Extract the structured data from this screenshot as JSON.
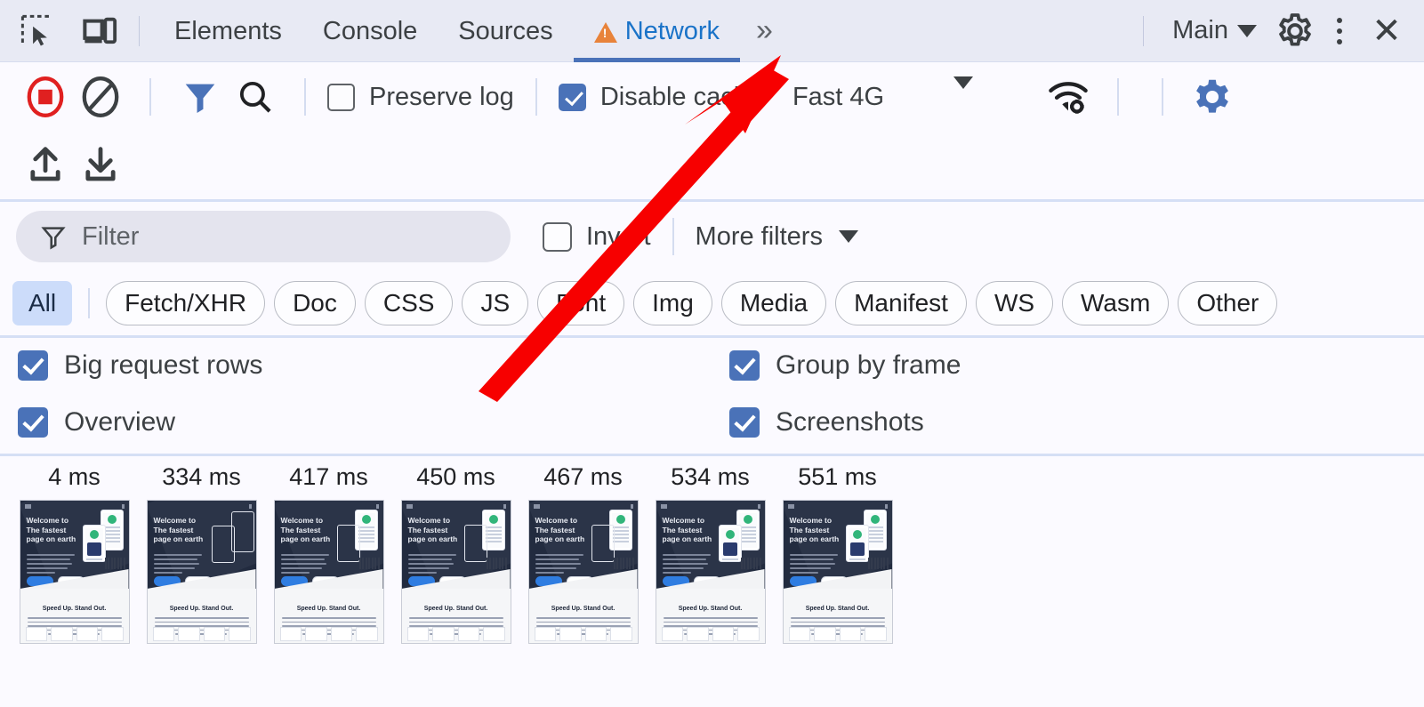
{
  "tabbar": {
    "inspect_icon": "inspect-element-icon",
    "device_icon": "device-toolbar-icon",
    "tabs": [
      {
        "label": "Elements",
        "active": false,
        "warning": false
      },
      {
        "label": "Console",
        "active": false,
        "warning": false
      },
      {
        "label": "Sources",
        "active": false,
        "warning": false
      },
      {
        "label": "Network",
        "active": true,
        "warning": true
      }
    ],
    "more_tabs": "»",
    "context_label": "Main",
    "settings_icon": "gear-icon",
    "more_icon": "kebab-menu-icon",
    "close_icon": "close-icon"
  },
  "network_toolbar": {
    "record_label": "record-button",
    "clear_label": "clear-button",
    "filter_toggle_label": "filter-toggle-button",
    "search_label": "search-button",
    "preserve_log": {
      "label": "Preserve log",
      "checked": false
    },
    "disable_cache": {
      "label": "Disable cache",
      "checked": true
    },
    "throttle": {
      "value": "Fast 4G"
    },
    "network_conditions_label": "network-conditions-icon",
    "settings_label": "network-settings-icon",
    "import_label": "import-har-icon",
    "export_label": "export-har-icon"
  },
  "filter_row": {
    "filter_placeholder": "Filter",
    "invert": {
      "label": "Invert",
      "checked": false
    },
    "more_filters": "More filters"
  },
  "type_filters": [
    {
      "label": "All",
      "selected": true
    },
    {
      "label": "Fetch/XHR",
      "selected": false
    },
    {
      "label": "Doc",
      "selected": false
    },
    {
      "label": "CSS",
      "selected": false
    },
    {
      "label": "JS",
      "selected": false
    },
    {
      "label": "Font",
      "selected": false
    },
    {
      "label": "Img",
      "selected": false
    },
    {
      "label": "Media",
      "selected": false
    },
    {
      "label": "Manifest",
      "selected": false
    },
    {
      "label": "WS",
      "selected": false
    },
    {
      "label": "Wasm",
      "selected": false
    },
    {
      "label": "Other",
      "selected": false
    }
  ],
  "options": [
    {
      "label": "Big request rows",
      "checked": true
    },
    {
      "label": "Group by frame",
      "checked": true
    },
    {
      "label": "Overview",
      "checked": true
    },
    {
      "label": "Screenshots",
      "checked": true
    }
  ],
  "filmstrip": {
    "frames": [
      {
        "time": "4 ms",
        "state": "full"
      },
      {
        "time": "334 ms",
        "state": "empty"
      },
      {
        "time": "417 ms",
        "state": "partial-right"
      },
      {
        "time": "450 ms",
        "state": "partial-right"
      },
      {
        "time": "467 ms",
        "state": "partial-right"
      },
      {
        "time": "534 ms",
        "state": "near-full"
      },
      {
        "time": "551 ms",
        "state": "full"
      }
    ],
    "thumbnail": {
      "hero_heading": "Welcome to The fastest page on earth",
      "section_heading": "Speed Up. Stand Out."
    }
  },
  "annotation": {
    "arrow_color": "#f70000",
    "name": "red-pointer-arrow"
  },
  "colors": {
    "accent_blue": "#4a72b8",
    "tab_active": "#1a73c8",
    "warning_orange": "#e8833a",
    "record_red": "#e02020",
    "chip_selected_bg": "#ccdcfa"
  }
}
